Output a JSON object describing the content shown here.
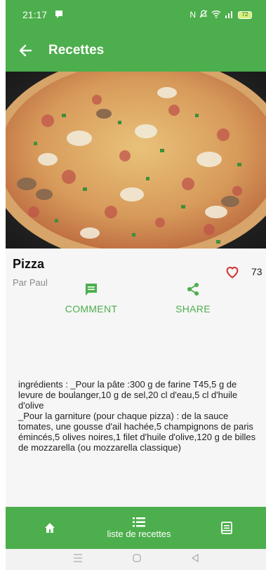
{
  "status_bar": {
    "time": "21:17",
    "battery_level": "72"
  },
  "app_bar": {
    "title": "Recettes",
    "back_icon": "arrow-left-icon"
  },
  "hero": {
    "icon": "pizza-photo"
  },
  "recipe": {
    "title": "Pizza",
    "author": "Par Paul",
    "likes": "73",
    "ingredients": "ingrédients : _Pour la pâte :300 g de farine T45,5 g de levure de boulanger,10 g de sel,20 cl d'eau,5 cl d'huile d'olive\n_Pour la garniture (pour chaque pizza) : de la sauce tomates, une gousse d'ail hachée,5 champignons de paris émincés,5 olives noires,1 filet d'huile d'olive,120 g de billes de mozzarella (ou mozzarella classique)"
  },
  "actions": {
    "comment_label": "COMMENT",
    "share_label": "SHARE"
  },
  "bottom_nav": {
    "list_label": "liste de recettes"
  },
  "colors": {
    "primary": "#4cae4c",
    "heart": "#d32f2f",
    "background": "#f6f6f6"
  }
}
